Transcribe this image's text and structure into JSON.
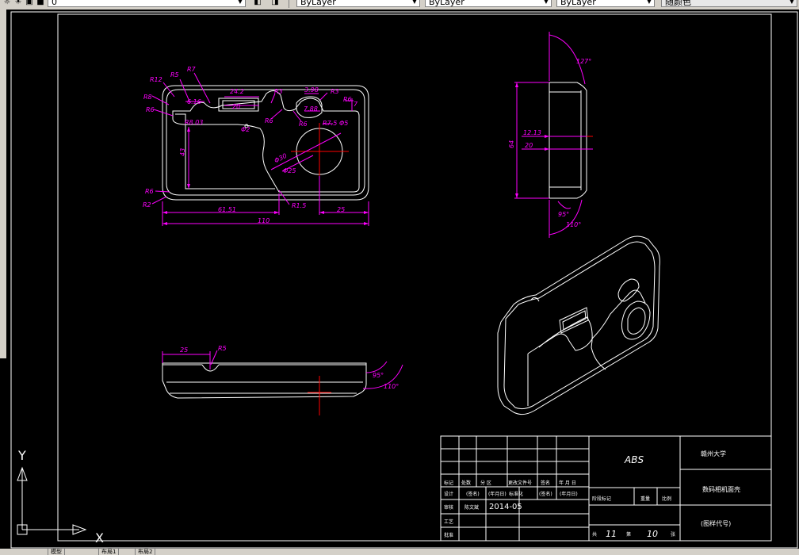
{
  "toolbar": {
    "layer_value": "0",
    "color_value": "ByLayer",
    "linetype_value": "ByLayer",
    "lineweight_value": "ByLayer",
    "plotstyle_value": "随颜色"
  },
  "dimensions": {
    "front": {
      "r12": "R12",
      "r5": "R5",
      "r7": "R7",
      "r8": "R8",
      "r6a": "R6",
      "d242": "24.2",
      "d20": "20",
      "d616": "6.16",
      "r3a": "R3",
      "d398": "3.98",
      "r3b": "R3",
      "r6b": "R6",
      "r6c": "R6",
      "r803": "R8.03",
      "phi2": "Φ2",
      "r6d": "R6",
      "d788": "7.88",
      "d7": "7",
      "r75": "R7.5",
      "phi5": "Φ5",
      "d43": "43",
      "phi30": "Φ30",
      "phi25": "Φ25",
      "r6e": "R6",
      "r2": "R2",
      "r15": "R1.5",
      "d6151": "61.51",
      "d25": "25",
      "d110": "110"
    },
    "side": {
      "a127": "127°",
      "d1213": "12.13",
      "d20": "20",
      "d64": "64",
      "a95": "95°",
      "a110": "110°"
    },
    "bottom": {
      "d25": "25",
      "r5": "R5",
      "a95": "95°",
      "a110": "110°"
    }
  },
  "ucs": {
    "y_label": "Y",
    "x_label": "X"
  },
  "title_block": {
    "material": "ABS",
    "school": "赣州大学",
    "drawing_name": "数码相机面壳",
    "drawing_code": "(图样代号)",
    "row_headers": [
      "标记",
      "处数",
      "分 区",
      "更改文件号",
      "签名",
      "年 月 日"
    ],
    "design_label": "设计",
    "standard_sign": "(签名)",
    "date_sign": "(年月日)",
    "standardize_label": "标准化",
    "review_label": "审核",
    "designer_name": "陈文斌",
    "design_date": "2014-05",
    "process_label": "工艺",
    "approve_label": "批准",
    "stage_label": "阶段标记",
    "weight_label": "重量",
    "scale_label": "比例",
    "sheets_total_label": "共",
    "sheets_total": "11",
    "sheet_label": "第",
    "sheet_no": "10",
    "sheet_unit": "张"
  },
  "tabs": [
    "模型",
    "布局1",
    "布局2"
  ],
  "colors": {
    "background": "#000000",
    "outline": "#ffffff",
    "dimension": "#ff00ff",
    "centerline": "#ff0000",
    "toolbar": "#d4d0c8"
  }
}
